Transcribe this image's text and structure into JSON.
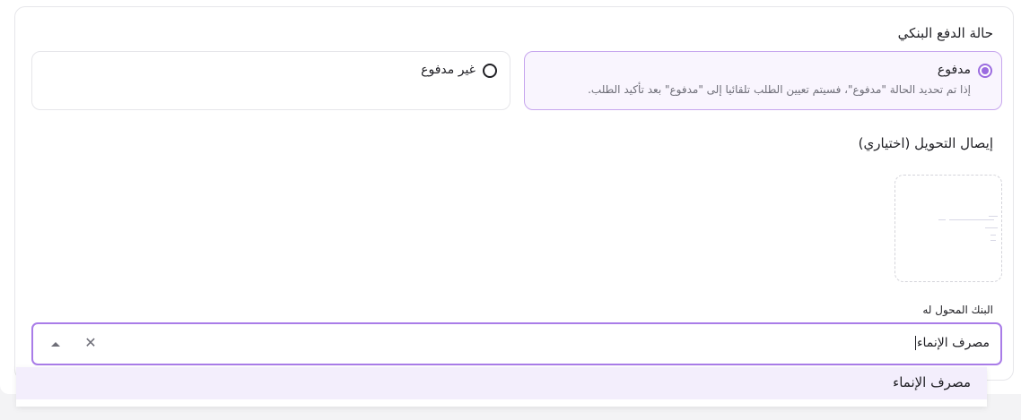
{
  "payment_status": {
    "title": "حالة الدفع البنكي",
    "options": [
      {
        "label": "مدفوع",
        "help": "إذا تم تحديد الحالة \"مدفوع\"، فسيتم تعيين الطلب تلقائيا إلى \"مدفوع\" بعد تأكيد الطلب.",
        "selected": true
      },
      {
        "label": "غير مدفوع",
        "selected": false
      }
    ]
  },
  "receipt": {
    "title": "إيصال التحويل (اختياري)"
  },
  "bank_field": {
    "label": "البنك المحول له",
    "value": "مصرف الإنماء",
    "icons": {
      "clear": "close-icon",
      "toggle": "chevron-up-icon"
    }
  },
  "dropdown": {
    "items": [
      "مصرف الإنماء"
    ]
  },
  "colors": {
    "accent": "#9b6ce0",
    "focus_border": "#a97ce8",
    "selected_bg": "#f9f5fe",
    "highlight_bg": "#f3eefc"
  }
}
